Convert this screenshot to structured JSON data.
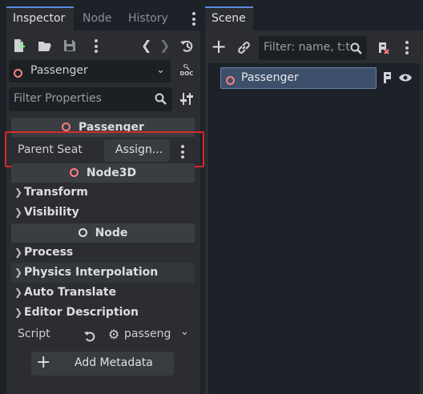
{
  "left_dock": {
    "tabs": [
      {
        "label": "Inspector",
        "active": true
      },
      {
        "label": "Node",
        "active": false
      },
      {
        "label": "History",
        "active": false
      }
    ]
  },
  "right_dock": {
    "tabs": [
      {
        "label": "Scene",
        "active": true
      }
    ]
  },
  "inspector": {
    "object_name": "Passenger",
    "filter_placeholder": "Filter Properties",
    "sections": {
      "passenger": "Passenger",
      "node3d": "Node3D",
      "node": "Node"
    },
    "parent_seat": {
      "label": "Parent Seat",
      "value": "Assign..."
    },
    "categories": {
      "transform": "Transform",
      "visibility": "Visibility",
      "process": "Process",
      "physics_interpolation": "Physics Interpolation",
      "auto_translate": "Auto Translate",
      "editor_description": "Editor Description"
    },
    "script": {
      "label": "Script",
      "value": "passeng"
    },
    "add_metadata": "Add Metadata"
  },
  "scene": {
    "filter_placeholder": "Filter: name, t:ty",
    "tree": [
      {
        "name": "Passenger",
        "selected": true
      }
    ]
  },
  "colors": {
    "accent": "#5b8bd8",
    "node3d_icon": "#fc7f7f",
    "highlight_box": "#d62a2a",
    "selected_row": "#3d4f6a"
  }
}
